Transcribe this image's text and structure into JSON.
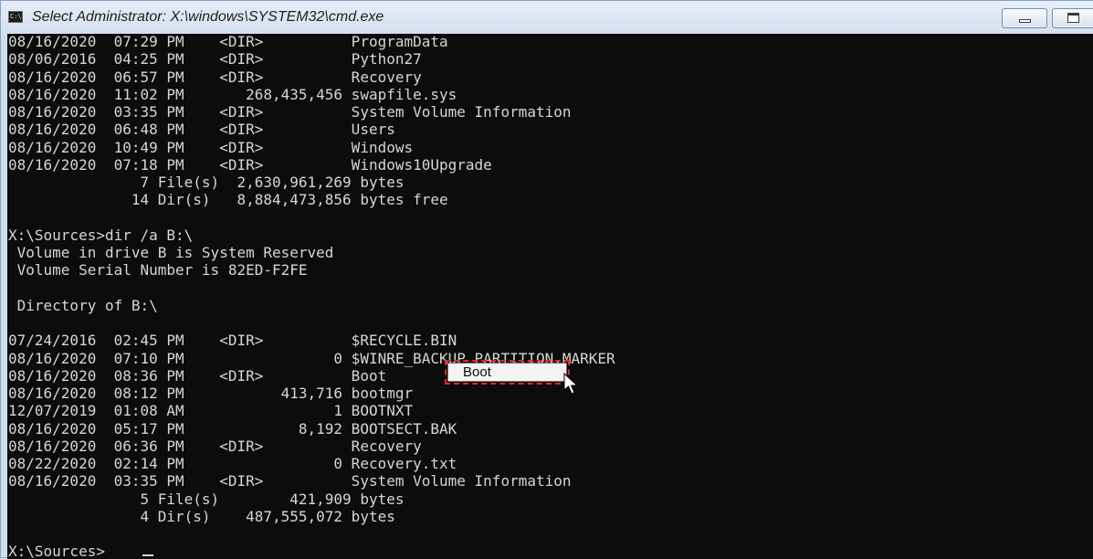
{
  "window": {
    "title": "Select Administrator: X:\\windows\\SYSTEM32\\cmd.exe",
    "app_icon_text": "C:\\",
    "controls": [
      "minimize",
      "maximize"
    ]
  },
  "console": {
    "lines": [
      "08/16/2020  07:29 PM    <DIR>          ProgramData",
      "08/06/2016  04:25 PM    <DIR>          Python27",
      "08/16/2020  06:57 PM    <DIR>          Recovery",
      "08/16/2020  11:02 PM       268,435,456 swapfile.sys",
      "08/16/2020  03:35 PM    <DIR>          System Volume Information",
      "08/16/2020  06:48 PM    <DIR>          Users",
      "08/16/2020  10:49 PM    <DIR>          Windows",
      "08/16/2020  07:18 PM    <DIR>          Windows10Upgrade",
      "               7 File(s)  2,630,961,269 bytes",
      "              14 Dir(s)   8,884,473,856 bytes free",
      "",
      "X:\\Sources>dir /a B:\\",
      " Volume in drive B is System Reserved",
      " Volume Serial Number is 82ED-F2FE",
      "",
      " Directory of B:\\",
      "",
      "07/24/2016  02:45 PM    <DIR>          $RECYCLE.BIN",
      "08/16/2020  07:10 PM                 0 $WINRE_BACKUP_PARTITION.MARKER",
      "08/16/2020  08:36 PM    <DIR>          Boot",
      "08/16/2020  08:12 PM           413,716 bootmgr",
      "12/07/2019  01:08 AM                 1 BOOTNXT",
      "08/16/2020  05:17 PM             8,192 BOOTSECT.BAK",
      "08/16/2020  06:36 PM    <DIR>          Recovery",
      "08/22/2020  02:14 PM                 0 Recovery.txt",
      "08/16/2020  03:35 PM    <DIR>          System Volume Information",
      "               5 File(s)        421,909 bytes",
      "               4 Dir(s)    487,555,072 bytes",
      "",
      "X:\\Sources>"
    ]
  },
  "highlight": {
    "label": "Boot",
    "color": "#e3262d"
  },
  "colors": {
    "console_bg": "#0c0c0c",
    "console_fg": "#d6d6d6",
    "titlebar": "#d3e0ef"
  }
}
